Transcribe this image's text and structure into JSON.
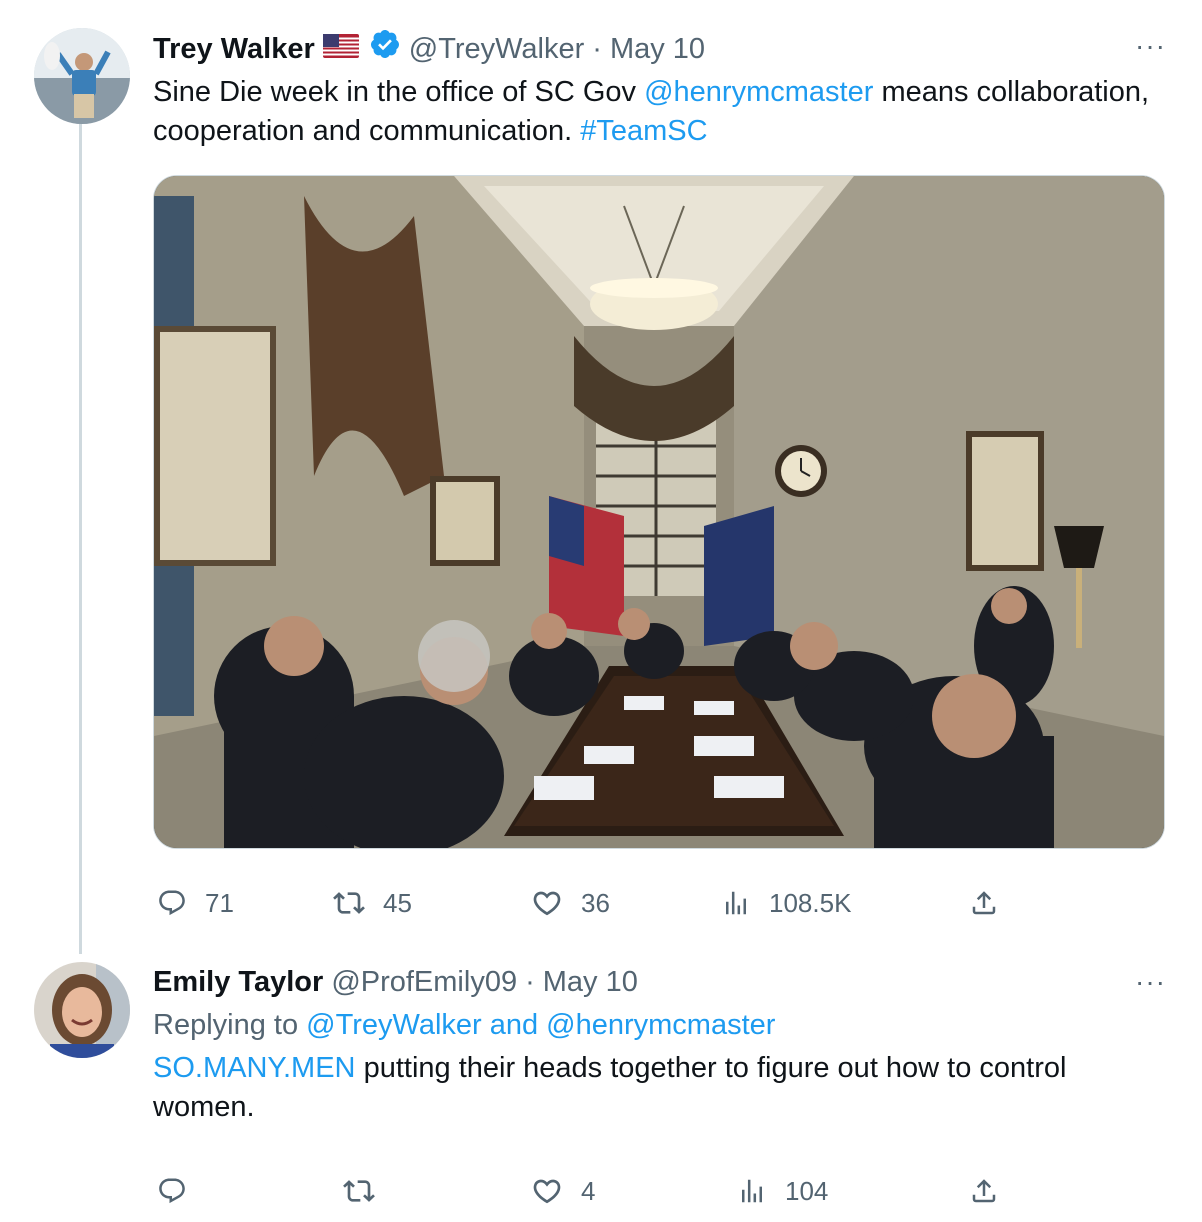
{
  "tweet1": {
    "name": "Trey Walker",
    "handle": "@TreyWalker",
    "separator": "·",
    "date": "May 10",
    "text_before": "Sine Die week in the office of SC Gov ",
    "mention": "@henrymcmaster",
    "text_middle": " means collaboration, cooperation and communication. ",
    "hashtag": "#TeamSC",
    "more": "···",
    "media_alt": "Meeting around a conference table in the SC Governor's office",
    "stats": {
      "replies": "71",
      "retweets": "45",
      "likes": "36",
      "views": "108.5K"
    }
  },
  "tweet2": {
    "name": "Emily Taylor",
    "handle": "@ProfEmily09",
    "separator": "·",
    "date": "May 10",
    "replying_prefix": "Replying to ",
    "reply_mention_1": "@TreyWalker",
    "reply_and": " and ",
    "reply_mention_2": "@henrymcmaster",
    "text_link": "SO.MANY.MEN",
    "text_rest": " putting their heads together to figure out how to control women.",
    "more": "···",
    "stats": {
      "replies": "",
      "retweets": "",
      "likes": "4",
      "views": "104"
    }
  },
  "colors": {
    "link": "#1d9bf0",
    "secondary": "#536471",
    "thread": "#cfd9de",
    "verified": "#1d9bf0"
  },
  "icons": [
    "reply-icon",
    "retweet-icon",
    "like-icon",
    "views-icon",
    "share-icon",
    "verified-badge-icon",
    "us-flag-icon",
    "more-icon"
  ]
}
